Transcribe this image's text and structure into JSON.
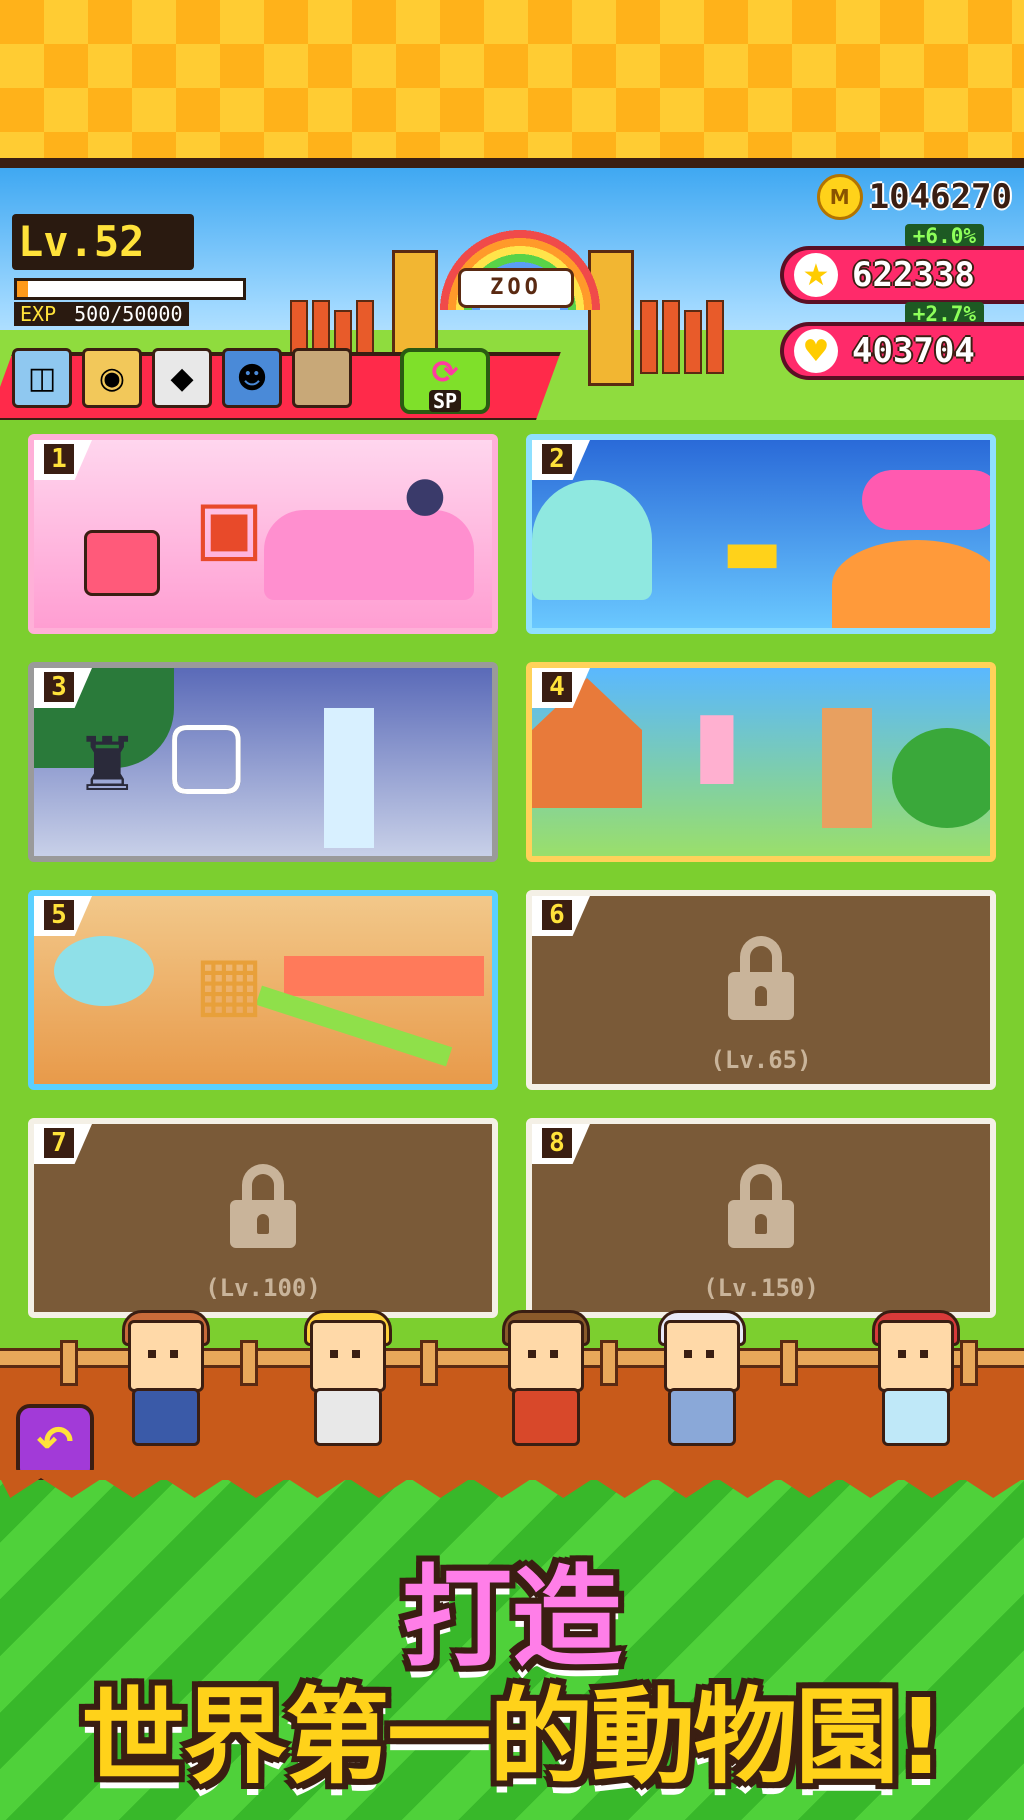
{
  "header": {
    "level_label": "Lv.52",
    "exp_label": "EXP",
    "exp_value": "500/50000",
    "exp_progress": 0.01,
    "gate_sign": "ZOO"
  },
  "currency": {
    "coin_icon": "M",
    "coins": "1046270",
    "star_bonus": "+6.0%",
    "stars": "622338",
    "heart_bonus": "+2.7%",
    "hearts": "403704"
  },
  "staff_bar": {
    "slots": [
      "robot-icon",
      "cow-icon",
      "cat-icon",
      "kid-icon",
      "empty-slot"
    ],
    "sp_label": "SP"
  },
  "areas": [
    {
      "num": "1",
      "theme": "toy-room",
      "locked": false
    },
    {
      "num": "2",
      "theme": "undersea",
      "locked": false
    },
    {
      "num": "3",
      "theme": "samurai-valley",
      "locked": false
    },
    {
      "num": "4",
      "theme": "flower-village",
      "locked": false
    },
    {
      "num": "5",
      "theme": "toy-shop",
      "locked": false
    },
    {
      "num": "6",
      "locked": true,
      "requirement": "(Lv.65)"
    },
    {
      "num": "7",
      "locked": true,
      "requirement": "(Lv.100)"
    },
    {
      "num": "8",
      "locked": true,
      "requirement": "(Lv.150)"
    }
  ],
  "promo": {
    "line1": "打造",
    "line2": "世界第一的動物園!"
  },
  "colors": {
    "accent_pink": "#ff2a6a",
    "gold": "#ffd21a",
    "grass": "#7ccf2f"
  }
}
